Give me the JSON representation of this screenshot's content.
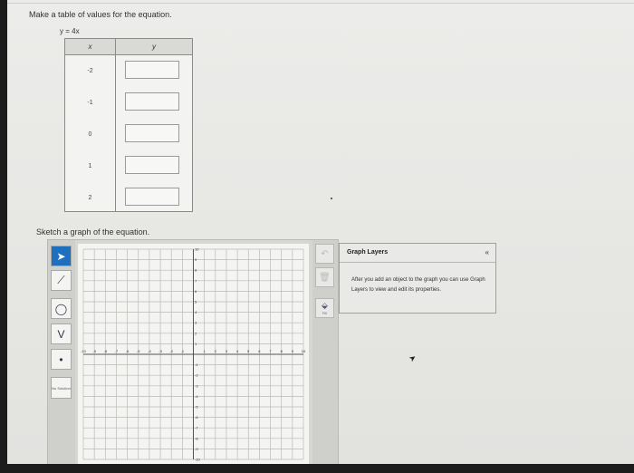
{
  "problem": {
    "instruction": "Make a table of values for the equation.",
    "equation": "y = 4x",
    "sketch_instruction": "Sketch a graph of the equation."
  },
  "table": {
    "x_header": "x",
    "y_header": "y",
    "rows": [
      {
        "x": "-2",
        "y": ""
      },
      {
        "x": "-1",
        "y": ""
      },
      {
        "x": "0",
        "y": ""
      },
      {
        "x": "1",
        "y": ""
      },
      {
        "x": "2",
        "y": ""
      }
    ]
  },
  "graph": {
    "x_min": -10,
    "x_max": 10,
    "y_min": -10,
    "y_max": 10,
    "x_ticks": [
      "-10",
      "-9",
      "-8",
      "-7",
      "-6",
      "-5",
      "-4",
      "-3",
      "-2",
      "-1",
      "1",
      "2",
      "3",
      "4",
      "5",
      "6",
      "7",
      "8",
      "9",
      "10"
    ],
    "y_ticks": [
      "10",
      "9",
      "8",
      "7",
      "6",
      "5",
      "4",
      "3",
      "2",
      "1",
      "-1",
      "-2",
      "-3",
      "-4",
      "-5",
      "-6",
      "-7",
      "-8",
      "-9",
      "-10"
    ],
    "grid": true
  },
  "toolbar": {
    "tools": [
      {
        "icon": "arrow-pointer-icon"
      },
      {
        "icon": "line-tool-icon"
      },
      {
        "icon": "circle-tool-icon"
      },
      {
        "icon": "parabola-tool-icon"
      },
      {
        "icon": "point-tool-icon"
      }
    ],
    "no_solution_label": "No Solution",
    "fill_label": "Fill"
  },
  "layers_panel": {
    "title": "Graph Layers",
    "collapse": "«",
    "description": "After you add an object to the graph you can use Graph Layers to view and edit its properties."
  },
  "colors": {
    "selected_tool": "#1f6fbf",
    "grid_line": "#b9b9b6",
    "axis": "#555555"
  }
}
